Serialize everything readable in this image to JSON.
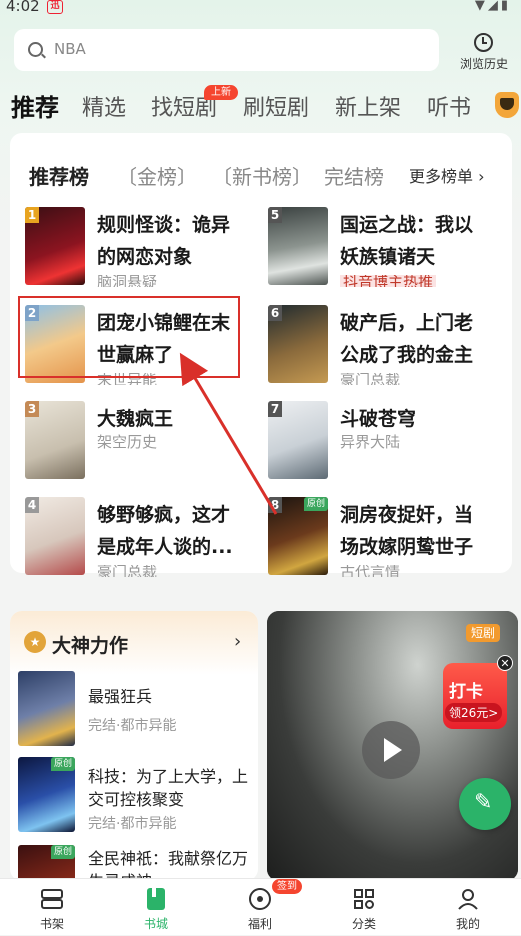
{
  "status": {
    "time": "4:02",
    "app_badge": "迅"
  },
  "search": {
    "placeholder": "NBA"
  },
  "history": {
    "label": "浏览历史"
  },
  "tabs": {
    "active": "推荐",
    "items": [
      "精选",
      "找短剧",
      "刷短剧",
      "新上架",
      "听书"
    ],
    "badge": "上新"
  },
  "ranking": {
    "title": "推荐榜",
    "tabs": [
      "金榜",
      "新书榜",
      "完结榜"
    ],
    "more": "更多榜单 ›"
  },
  "books": [
    {
      "rank": "1",
      "title": "规则怪谈：诡异的网恋对象",
      "sub": "脑洞悬疑"
    },
    {
      "rank": "2",
      "title": "团宠小锦鲤在末世赢麻了",
      "sub": "末世异能"
    },
    {
      "rank": "3",
      "title": "大魏疯王",
      "sub": "架空历史"
    },
    {
      "rank": "4",
      "title": "够野够疯，这才是成年人谈的...",
      "sub": "豪门总裁"
    },
    {
      "rank": "5",
      "title": "国运之战：我以妖族镇诸天",
      "sub": "抖音博主热推"
    },
    {
      "rank": "6",
      "title": "破产后，上门老公成了我的金主",
      "sub": "豪门总裁"
    },
    {
      "rank": "7",
      "title": "斗破苍穹",
      "sub": "异界大陆"
    },
    {
      "rank": "8",
      "title": "洞房夜捉奸，当场改嫁阴鸷世子",
      "sub": "古代言情",
      "tag": "原创"
    }
  ],
  "dashen": {
    "title": "大神力作",
    "arrow": "›",
    "books": [
      {
        "title": "最强狂兵",
        "sub": "完结·都市异能"
      },
      {
        "title": "科技：为了上大学，上交可控核聚变",
        "sub": "完结·都市异能",
        "tag": "原创"
      },
      {
        "title": "全民神祇：我献祭亿万生灵成神",
        "sub": "",
        "tag": "原创"
      }
    ]
  },
  "video": {
    "tag": "短剧"
  },
  "daka": {
    "title": "打卡",
    "sub": "领26元>",
    "close": "✕"
  },
  "nav": {
    "items": [
      "书架",
      "书城",
      "福利",
      "分类",
      "我的"
    ],
    "badge": "签到",
    "active_color": "#2bb369"
  },
  "colors": {
    "accent": "#2bb369",
    "badge_red": "#f5452f",
    "highlight": "#d9302a"
  }
}
